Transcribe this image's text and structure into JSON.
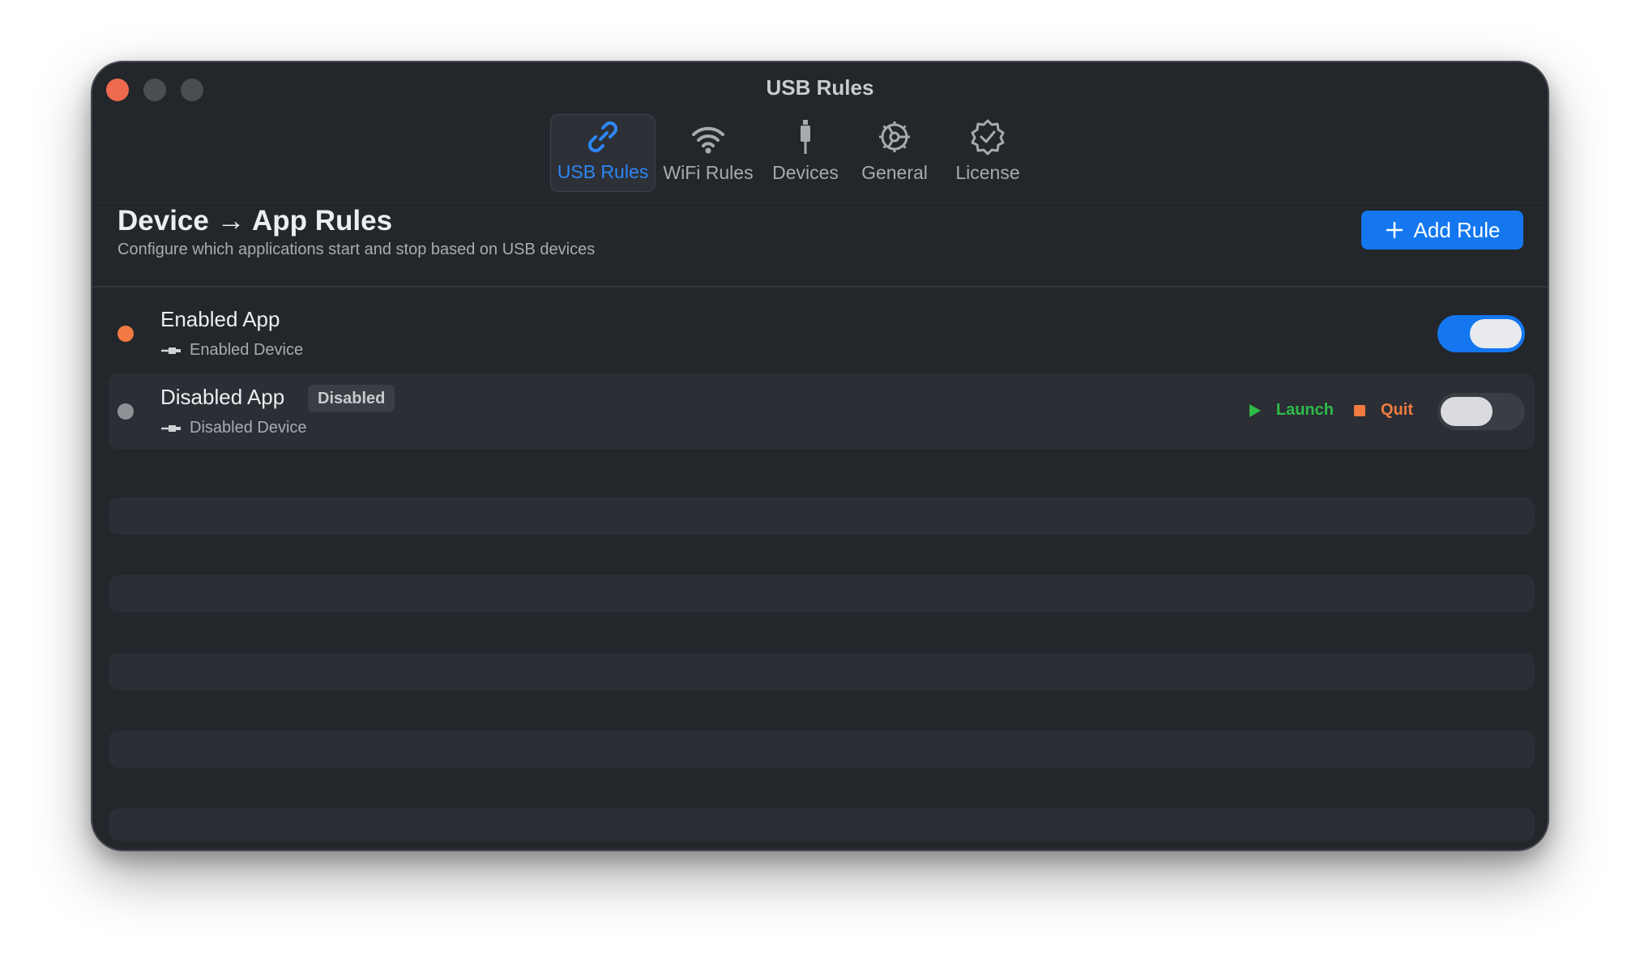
{
  "window": {
    "title": "USB Rules",
    "colors": {
      "background": "#23262b",
      "accent": "#1477f0"
    }
  },
  "toolbar": {
    "tabs": [
      {
        "label": "USB Rules",
        "icon": "link-icon",
        "active": true
      },
      {
        "label": "WiFi Rules",
        "icon": "wifi-icon",
        "active": false
      },
      {
        "label": "Devices",
        "icon": "usb-connector-icon",
        "active": false
      },
      {
        "label": "General",
        "icon": "gear-icon",
        "active": false
      },
      {
        "label": "License",
        "icon": "checkmark-seal-icon",
        "active": false
      }
    ]
  },
  "section": {
    "title": "Device → App Rules",
    "subtitle": "Configure which applications start and stop based on USB devices",
    "add_button": "Add Rule"
  },
  "rules": [
    {
      "app": "Enabled App",
      "device": "Enabled Device",
      "status_color": "#f07a42",
      "enabled": true,
      "badge": ""
    },
    {
      "app": "Disabled App",
      "device": "Disabled Device",
      "status_color": "#8e9196",
      "enabled": false,
      "badge": "Disabled",
      "launch_label": "Launch",
      "quit_label": "Quit"
    }
  ]
}
